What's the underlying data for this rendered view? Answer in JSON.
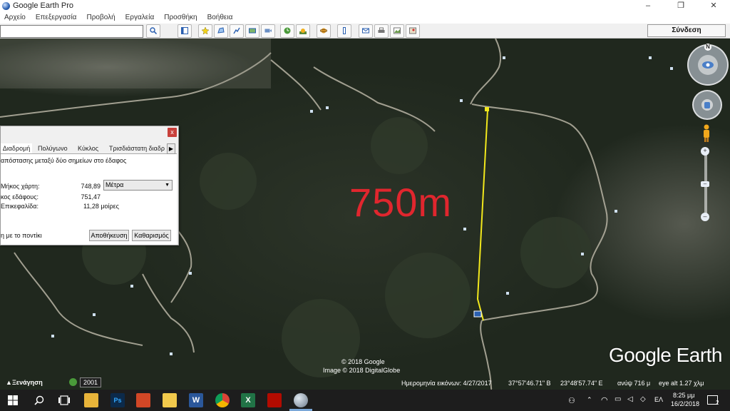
{
  "window": {
    "title": "Google Earth Pro",
    "min": "–",
    "max": "❐",
    "close": "✕"
  },
  "menu": [
    "Αρχείο",
    "Επεξεργασία",
    "Προβολή",
    "Εργαλεία",
    "Προσθήκη",
    "Βοήθεια"
  ],
  "toolbar": {
    "search_value": "",
    "login_label": "Σύνδεση"
  },
  "overlay": {
    "distance_text": "750m",
    "distance_color": "#e0262e",
    "line_color": "#f2e81c"
  },
  "measure_dialog": {
    "close_label": "x",
    "tabs": [
      "Διαδρομή",
      "Πολύγωνο",
      "Κύκλος",
      "Τρισδιάστατη διαδρ"
    ],
    "tab_arrow": "▶",
    "description": "απόστασης μεταξύ δύο σημείων στο έδαφος",
    "map_length_label": "Μήκος χάρτη:",
    "map_length_value": "748,89",
    "ground_length_label": "κος εδάφους:",
    "ground_length_value": "751,47",
    "heading_label": "Επικεφαλίδα:",
    "heading_value": "11,28 μοίρες",
    "unit": "Μέτρα",
    "mouse_label": "η με το ποντίκι",
    "save_label": "Αποθήκευση",
    "clear_label": "Καθαρισμός"
  },
  "map": {
    "copyright_1": "© 2018 Google",
    "copyright_2": "Image © 2018 DigitalGlobe",
    "logo_text": "Google Earth",
    "compass_letter": "N"
  },
  "status": {
    "tour_label": "Ξενάγηση",
    "year": "2001",
    "image_date": "Ημερομηνία εικόνων: 4/27/2017",
    "lat": "37°57'46.71\" Β",
    "lon": "23°48'57.74\" Ε",
    "elevation": "ανύψ  716 μ",
    "eye_alt": "eye alt  1.27 χλμ"
  },
  "taskbar": {
    "lang": "ΕΛ",
    "time": "8:25 μμ",
    "date": "16/2/2018",
    "notifications": "2"
  }
}
